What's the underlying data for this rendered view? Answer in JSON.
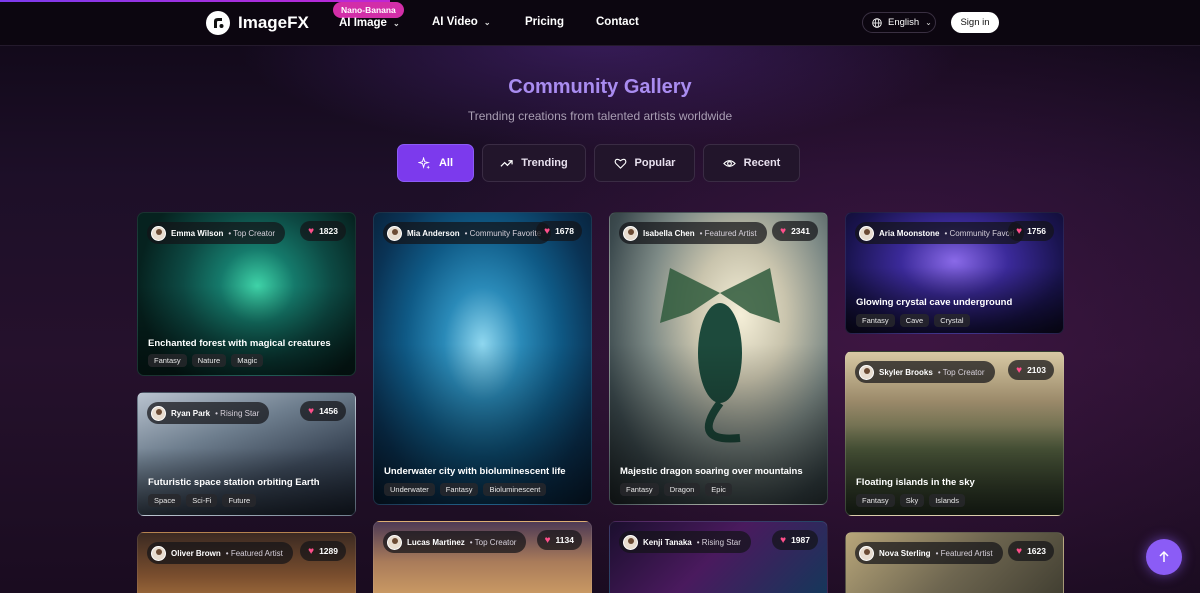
{
  "nav": {
    "brand": "ImageFX",
    "badge": "Nano-Banana",
    "items": [
      {
        "label": "AI Image",
        "has_dropdown": true
      },
      {
        "label": "AI Video",
        "has_dropdown": true
      },
      {
        "label": "Pricing",
        "has_dropdown": false
      },
      {
        "label": "Contact",
        "has_dropdown": false
      }
    ],
    "language": "English",
    "signin": "Sign in"
  },
  "hero": {
    "title": "Community Gallery",
    "subtitle": "Trending creations from talented artists worldwide"
  },
  "filters": [
    {
      "label": "All",
      "icon": "sparkles-icon",
      "active": true
    },
    {
      "label": "Trending",
      "icon": "trending-up-icon",
      "active": false
    },
    {
      "label": "Popular",
      "icon": "heart-icon",
      "active": false
    },
    {
      "label": "Recent",
      "icon": "eye-icon",
      "active": false
    }
  ],
  "cards": [
    {
      "author": "Emma Wilson",
      "role": "• Top Creator",
      "likes": "1823",
      "title": "Enchanted forest with magical creatures",
      "tags": [
        "Fantasy",
        "Nature",
        "Magic"
      ]
    },
    {
      "author": "Ryan Park",
      "role": "• Rising Star",
      "likes": "1456",
      "title": "Futuristic space station orbiting Earth",
      "tags": [
        "Space",
        "Sci-Fi",
        "Future"
      ]
    },
    {
      "author": "Oliver Brown",
      "role": "• Featured Artist",
      "likes": "1289",
      "title": "",
      "tags": []
    },
    {
      "author": "Mia Anderson",
      "role": "• Community Favorite",
      "likes": "1678",
      "title": "Underwater city with bioluminescent life",
      "tags": [
        "Underwater",
        "Fantasy",
        "Bioluminescent"
      ]
    },
    {
      "author": "Lucas Martinez",
      "role": "• Top Creator",
      "likes": "1134",
      "title": "",
      "tags": []
    },
    {
      "author": "Isabella Chen",
      "role": "• Featured Artist",
      "likes": "2341",
      "title": "Majestic dragon soaring over mountains",
      "tags": [
        "Fantasy",
        "Dragon",
        "Epic"
      ]
    },
    {
      "author": "Kenji Tanaka",
      "role": "• Rising Star",
      "likes": "1987",
      "title": "",
      "tags": []
    },
    {
      "author": "Aria Moonstone",
      "role": "• Community Favori",
      "likes": "1756",
      "title": "Glowing crystal cave underground",
      "tags": [
        "Fantasy",
        "Cave",
        "Crystal"
      ]
    },
    {
      "author": "Skyler Brooks",
      "role": "• Top Creator",
      "likes": "2103",
      "title": "Floating islands in the sky",
      "tags": [
        "Fantasy",
        "Sky",
        "Islands"
      ]
    },
    {
      "author": "Nova Sterling",
      "role": "• Featured Artist",
      "likes": "1623",
      "title": "",
      "tags": []
    }
  ],
  "colors": {
    "accent": "#7c3aed",
    "title": "#a98cf0",
    "badge": "#d22ea8",
    "heart": "#ff4f8b"
  }
}
